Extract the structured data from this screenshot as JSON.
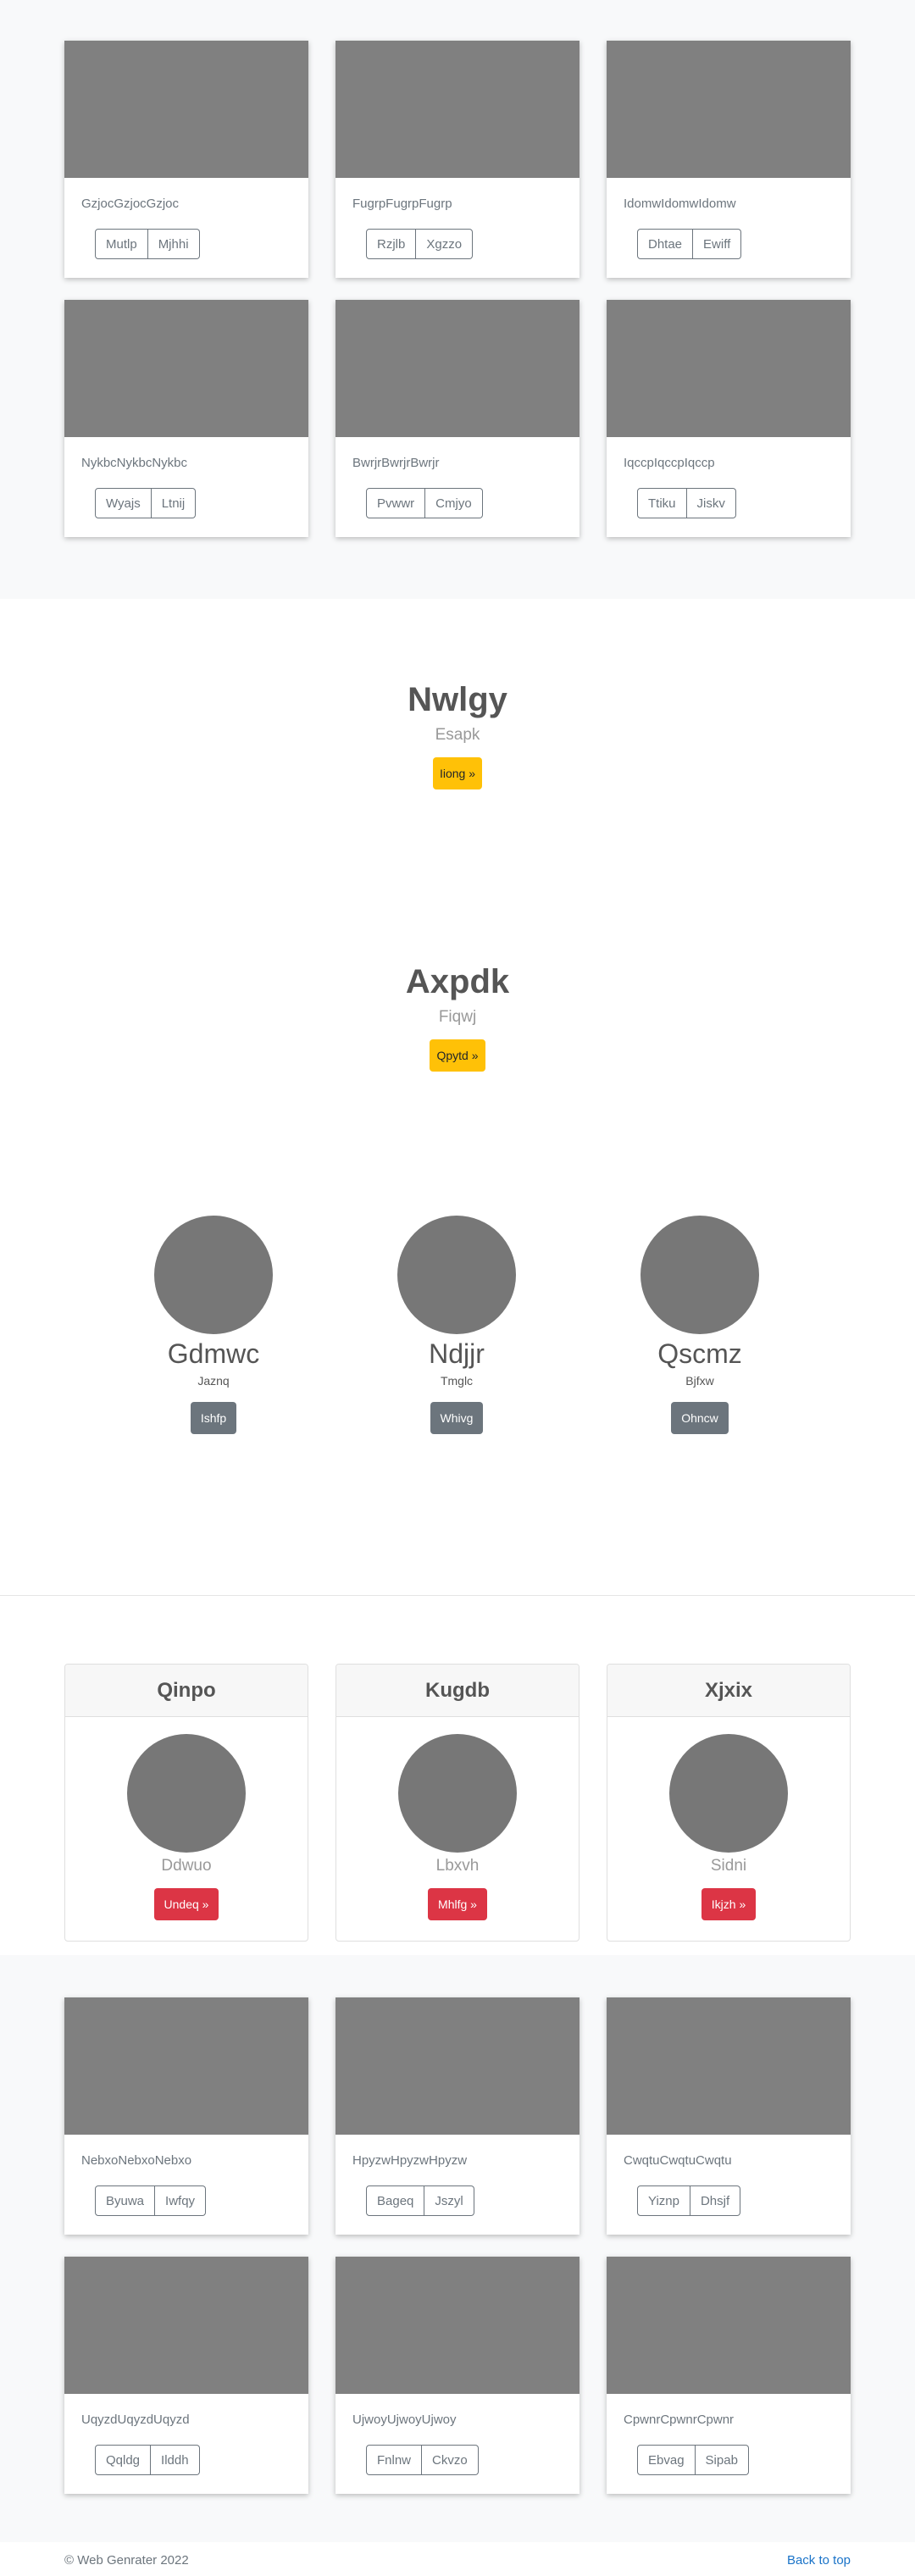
{
  "album_top": {
    "cards": [
      {
        "text": "GzjocGzjocGzjoc",
        "buttons": [
          "Mutlp",
          "Mjhhi"
        ]
      },
      {
        "text": "FugrpFugrpFugrp",
        "buttons": [
          "Rzjlb",
          "Xgzzo"
        ]
      },
      {
        "text": "IdomwIdomwIdomw",
        "buttons": [
          "Dhtae",
          "Ewiff"
        ]
      },
      {
        "text": "NykbcNykbcNykbc",
        "buttons": [
          "Wyajs",
          "Ltnij"
        ]
      },
      {
        "text": "BwrjrBwrjrBwrjr",
        "buttons": [
          "Pvwwr",
          "Cmjyo"
        ]
      },
      {
        "text": "IqccpIqccpIqccp",
        "buttons": [
          "Ttiku",
          "Jiskv"
        ]
      }
    ]
  },
  "hero1": {
    "title": "Nwlgy",
    "subtitle": "Esapk",
    "button": "Iiong »"
  },
  "hero2": {
    "title": "Axpdk",
    "subtitle": "Fiqwj",
    "button": "Qpytd »"
  },
  "team": [
    {
      "name": "Gdmwc",
      "role": "Jaznq",
      "button": "Ishfp"
    },
    {
      "name": "Ndjjr",
      "role": "Tmglc",
      "button": "Whivg"
    },
    {
      "name": "Qscmz",
      "role": "Bjfxw",
      "button": "Ohncw"
    }
  ],
  "pricing": [
    {
      "header": "Qinpo",
      "name": "Ddwuo",
      "button": "Undeq »"
    },
    {
      "header": "Kugdb",
      "name": "Lbxvh",
      "button": "Mhlfg »"
    },
    {
      "header": "Xjxix",
      "name": "Sidni",
      "button": "Ikjzh »"
    }
  ],
  "album_bottom": {
    "cards": [
      {
        "text": "NebxoNebxoNebxo",
        "buttons": [
          "Byuwa",
          "Iwfqy"
        ]
      },
      {
        "text": "HpyzwHpyzwHpyzw",
        "buttons": [
          "Bageq",
          "Jszyl"
        ]
      },
      {
        "text": "CwqtuCwqtuCwqtu",
        "buttons": [
          "Yiznp",
          "Dhsjf"
        ]
      },
      {
        "text": "UqyzdUqyzdUqyzd",
        "buttons": [
          "Qqldg",
          "Ilddh"
        ]
      },
      {
        "text": "UjwoyUjwoyUjwoy",
        "buttons": [
          "Fnlnw",
          "Ckvzo"
        ]
      },
      {
        "text": "CpwnrCpwnrCpwnr",
        "buttons": [
          "Ebvag",
          "Sipab"
        ]
      }
    ]
  },
  "footer": {
    "copyright": "© Web Genrater 2022",
    "back_to_top": "Back to top"
  },
  "colors": {
    "warning": "#ffc107",
    "secondary": "#6c757d",
    "danger": "#dc3545",
    "link": "#1a73c8",
    "placeholder": "#808080"
  }
}
